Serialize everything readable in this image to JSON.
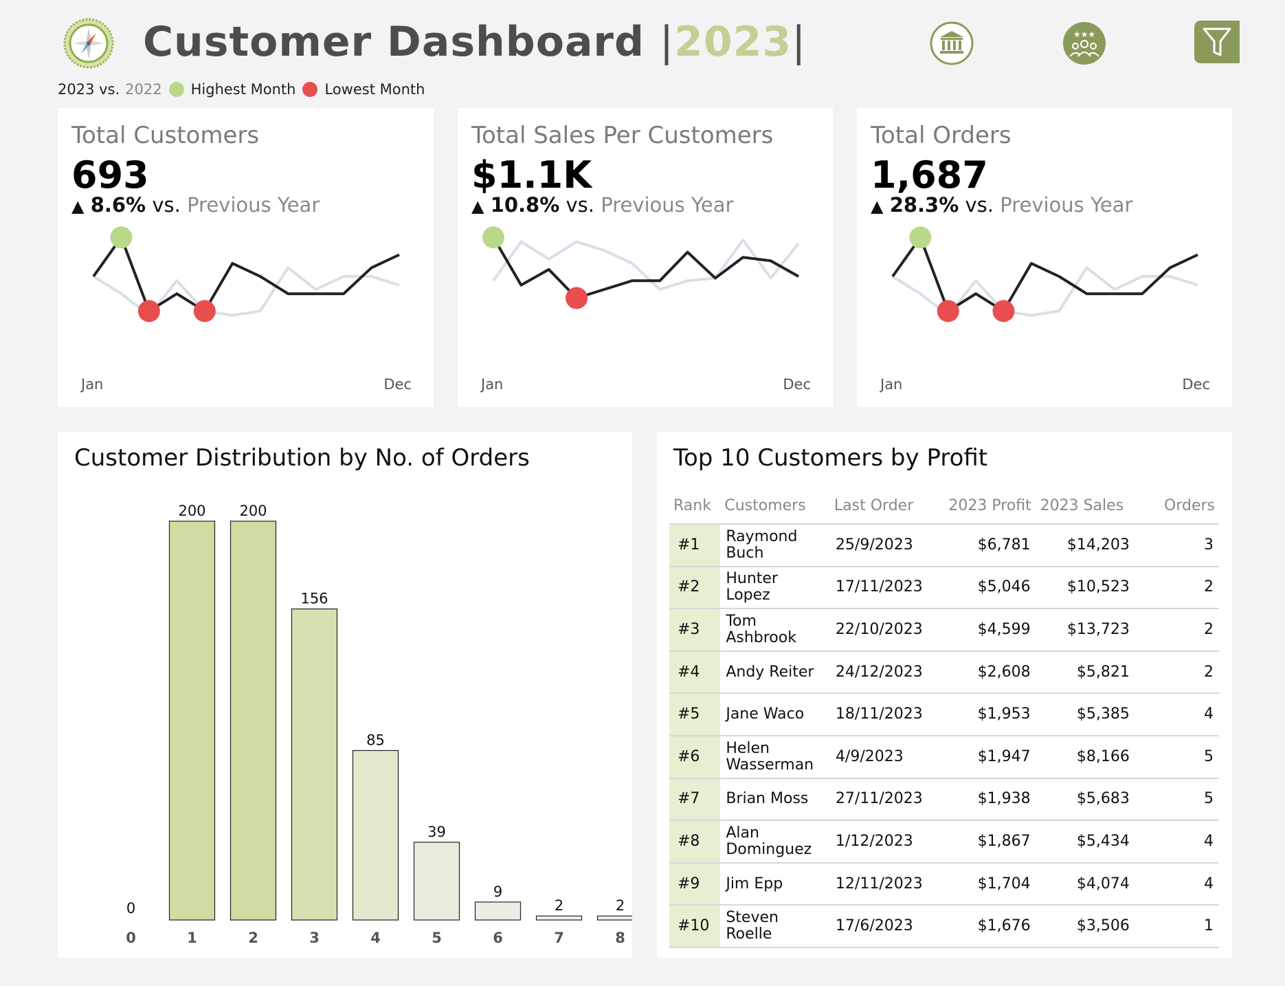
{
  "header": {
    "title": "Customer Dashboard",
    "bar_left": "|",
    "year": "2023",
    "bar_right": "|",
    "icons": [
      "bank-icon",
      "people-award-icon",
      "filter-icon"
    ]
  },
  "legend": {
    "current": "2023 vs.",
    "previous": "2022",
    "highest": "Highest Month",
    "lowest": "Lowest Month",
    "highest_color": "#b9d98a",
    "lowest_color": "#e84e4e"
  },
  "kpis": [
    {
      "title": "Total Customers",
      "value": "693",
      "arrow": "▲",
      "change": "8.6%",
      "vs": "vs.",
      "prev": "Previous Year",
      "start_label": "Jan",
      "end_label": "Dec",
      "current": [
        0.5,
        0.95,
        0.1,
        0.3,
        0.1,
        0.65,
        0.5,
        0.3,
        0.3,
        0.3,
        0.6,
        0.75
      ],
      "previous": [
        0.5,
        0.3,
        0.05,
        0.45,
        0.1,
        0.05,
        0.1,
        0.6,
        0.35,
        0.5,
        0.5,
        0.4
      ],
      "high_index": 1,
      "low_indices": [
        2,
        4
      ]
    },
    {
      "title": "Total Sales Per Customers",
      "value": "$1.1K",
      "arrow": "▲",
      "change": "10.8%",
      "vs": "vs.",
      "prev": "Previous Year",
      "start_label": "Jan",
      "end_label": "Dec",
      "current": [
        0.95,
        0.4,
        0.58,
        0.25,
        0.35,
        0.45,
        0.45,
        0.78,
        0.48,
        0.72,
        0.68,
        0.5
      ],
      "previous": [
        0.45,
        0.9,
        0.7,
        0.9,
        0.8,
        0.65,
        0.35,
        0.45,
        0.48,
        0.92,
        0.48,
        0.88
      ],
      "high_index": 0,
      "low_indices": [
        3
      ]
    },
    {
      "title": "Total Orders",
      "value": "1,687",
      "arrow": "▲",
      "change": "28.3%",
      "vs": "vs.",
      "prev": "Previous Year",
      "start_label": "Jan",
      "end_label": "Dec",
      "current": [
        0.5,
        0.95,
        0.1,
        0.3,
        0.1,
        0.65,
        0.5,
        0.3,
        0.3,
        0.3,
        0.6,
        0.75
      ],
      "previous": [
        0.5,
        0.3,
        0.05,
        0.45,
        0.1,
        0.05,
        0.1,
        0.6,
        0.35,
        0.5,
        0.5,
        0.4
      ],
      "high_index": 1,
      "low_indices": [
        2,
        4
      ]
    }
  ],
  "distribution": {
    "title": "Customer Distribution by No. of Orders"
  },
  "chart_data": {
    "type": "bar",
    "title": "Customer Distribution by No. of Orders",
    "categories": [
      "0",
      "1",
      "2",
      "3",
      "4",
      "5",
      "6",
      "7",
      "8"
    ],
    "values": [
      0,
      200,
      200,
      156,
      85,
      39,
      9,
      2,
      2
    ],
    "colors": [
      "#cfdca2",
      "#cfdca2",
      "#cfdca2",
      "#d5e1b1",
      "#e2e9cd",
      "#e8ecdd",
      "#eceee6",
      "#eeeeea",
      "#eeeeea"
    ],
    "ylim": [
      0,
      200
    ],
    "xlabel": "",
    "ylabel": "",
    "grid": false
  },
  "top10": {
    "title": "Top 10 Customers by Profit",
    "columns": [
      "Rank",
      "Customers",
      "Last Order",
      "2023 Profit",
      "2023 Sales",
      "Orders"
    ],
    "rows": [
      [
        "#1",
        "Raymond Buch",
        "25/9/2023",
        "$6,781",
        "$14,203",
        "3"
      ],
      [
        "#2",
        "Hunter Lopez",
        "17/11/2023",
        "$5,046",
        "$10,523",
        "2"
      ],
      [
        "#3",
        "Tom Ashbrook",
        "22/10/2023",
        "$4,599",
        "$13,723",
        "2"
      ],
      [
        "#4",
        "Andy Reiter",
        "24/12/2023",
        "$2,608",
        "$5,821",
        "2"
      ],
      [
        "#5",
        "Jane Waco",
        "18/11/2023",
        "$1,953",
        "$5,385",
        "4"
      ],
      [
        "#6",
        "Helen Wasserman",
        "4/9/2023",
        "$1,947",
        "$8,166",
        "5"
      ],
      [
        "#7",
        "Brian Moss",
        "27/11/2023",
        "$1,938",
        "$5,683",
        "5"
      ],
      [
        "#8",
        "Alan Dominguez",
        "1/12/2023",
        "$1,867",
        "$5,434",
        "4"
      ],
      [
        "#9",
        "Jim Epp",
        "12/11/2023",
        "$1,704",
        "$4,074",
        "4"
      ],
      [
        "#10",
        "Steven Roelle",
        "17/6/2023",
        "$1,676",
        "$3,506",
        "1"
      ]
    ]
  }
}
